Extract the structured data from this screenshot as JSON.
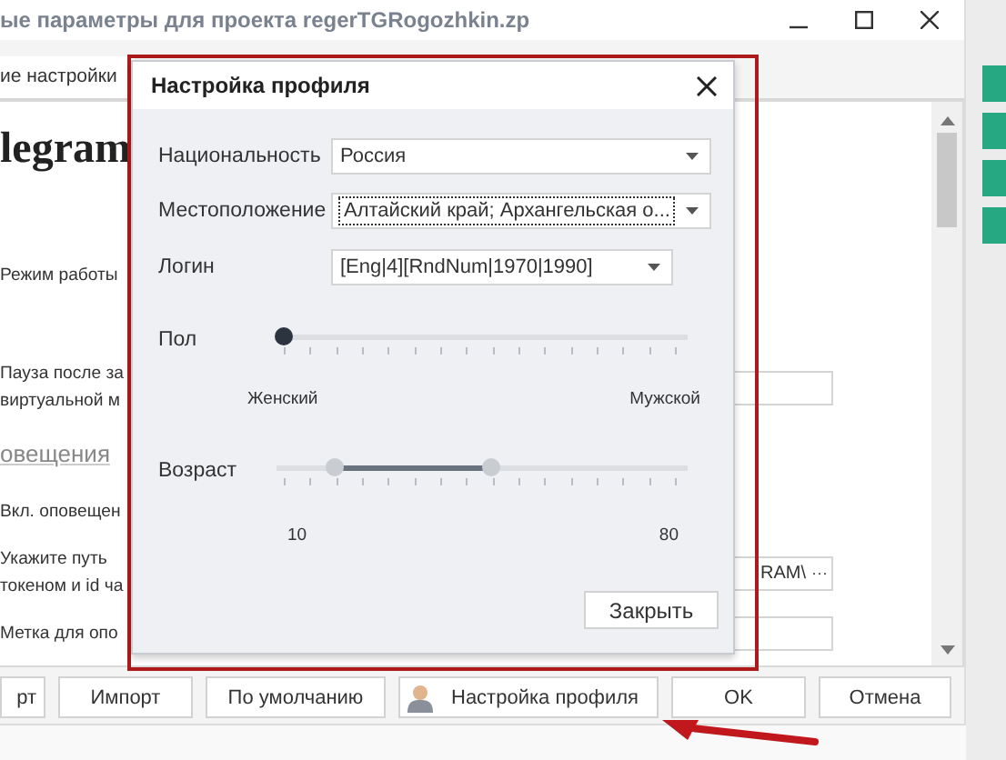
{
  "window": {
    "title": "ые параметры для проекта regerTGRogozhkin.zp"
  },
  "tabs": [
    {
      "label": "ие настройки",
      "selected": true
    }
  ],
  "content": {
    "heading": "legram",
    "rows": [
      {
        "kind": "label",
        "lines": [
          "Режим работы"
        ]
      },
      {
        "kind": "field",
        "lines": [
          "Пауза после за",
          "виртуальной м"
        ]
      },
      {
        "kind": "section",
        "lines": [
          "овещения"
        ]
      },
      {
        "kind": "label",
        "lines": [
          "Вкл. оповещен"
        ]
      },
      {
        "kind": "path",
        "lines": [
          "Укажите путь",
          "токеном и id ча"
        ],
        "value": "RAM\\",
        "button": "···"
      },
      {
        "kind": "field",
        "lines": [
          "Метка для опо"
        ]
      }
    ]
  },
  "bottom_buttons": [
    {
      "kind": "plain",
      "label": "рт"
    },
    {
      "kind": "plain",
      "label": "Импорт"
    },
    {
      "kind": "plain",
      "label": "По умолчанию"
    },
    {
      "kind": "profile",
      "label": "Настройка профиля"
    },
    {
      "kind": "plain",
      "label": "OK"
    },
    {
      "kind": "plain",
      "label": "Отмена"
    }
  ],
  "dialog": {
    "title": "Настройка профиля",
    "fields": [
      {
        "label": "Национальность",
        "value": "Россия",
        "focused": false
      },
      {
        "label": "Местоположение",
        "value": "Алтайский край; Архангельская о...",
        "focused": true
      },
      {
        "label": "Логин",
        "value": "[Eng|4][RndNum|1970|1990]",
        "focused": false
      }
    ],
    "sliders": [
      {
        "kind": "single",
        "label": "Пол",
        "level": 0,
        "min_label": "Женский",
        "max_label": "Мужской"
      },
      {
        "kind": "range",
        "label": "Возраст",
        "thumbs": [
          {
            "level": 0.14
          },
          {
            "level": 0.52
          }
        ],
        "min_label": "10",
        "max_label": "80"
      }
    ],
    "close_button": "Закрыть"
  }
}
